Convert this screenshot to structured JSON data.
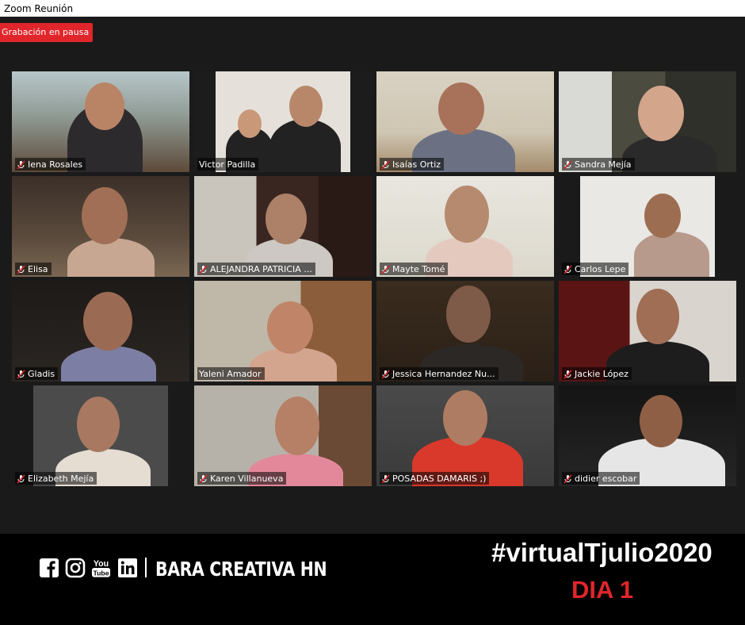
{
  "window": {
    "title": "Zoom Reunión"
  },
  "recording": {
    "status": "Grabación en pausa"
  },
  "participants": [
    {
      "name": "Iena Rosales"
    },
    {
      "name": "Victor Padilla"
    },
    {
      "name": "Isaías Ortiz"
    },
    {
      "name": "Sandra Mejía"
    },
    {
      "name": "Elisa"
    },
    {
      "name": "ALEJANDRA PATRICIA ..."
    },
    {
      "name": "Mayte Tomé"
    },
    {
      "name": "Carlos Lepe"
    },
    {
      "name": "Gladis"
    },
    {
      "name": "Yaleni Amador"
    },
    {
      "name": "Jessica Hernandez Nu..."
    },
    {
      "name": "Jackie López"
    },
    {
      "name": "Elizabeth Mejía"
    },
    {
      "name": "Karen Villanueva"
    },
    {
      "name": "POSADAS DAMARIS ;)"
    },
    {
      "name": "didier escobar"
    }
  ],
  "footer": {
    "social_icons": [
      "facebook-icon",
      "instagram-icon",
      "youtube-icon",
      "linkedin-icon"
    ],
    "youtube_you": "You",
    "youtube_tube": "Tube",
    "brand": "BARA CREATIVA HN",
    "hashtag": "#virtualTjulio2020",
    "day": "DIA 1"
  },
  "colors": {
    "recording_badge": "#e0262b",
    "active_speaker_outline": "#d8e36a",
    "day_text": "#e0262b"
  }
}
